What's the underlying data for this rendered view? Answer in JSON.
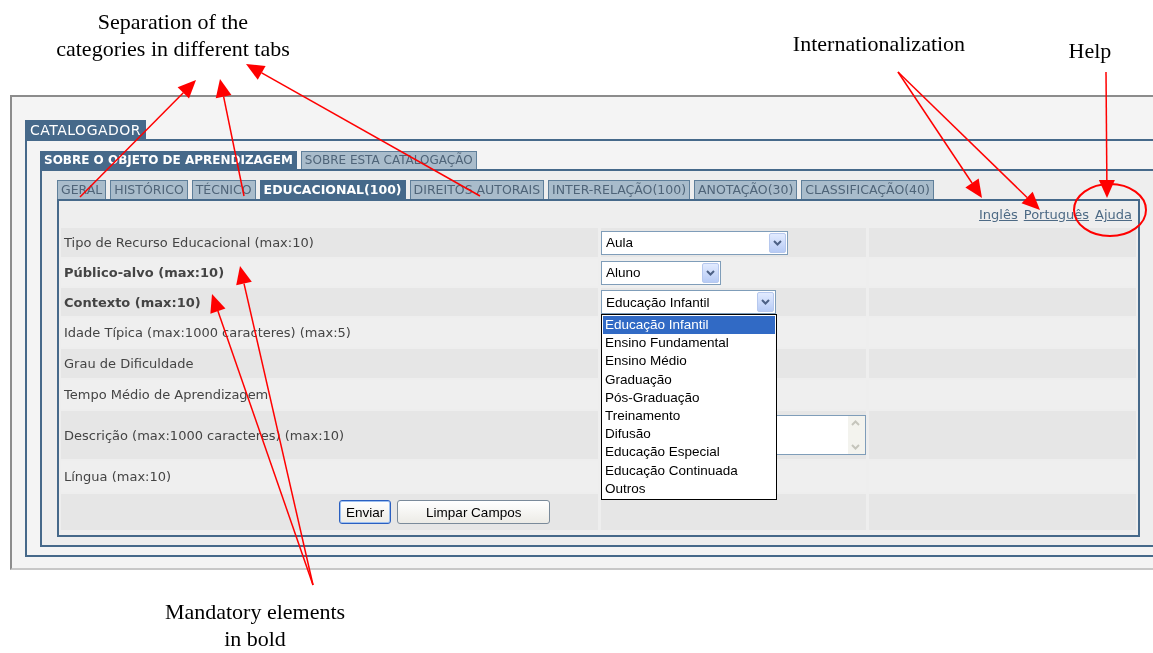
{
  "annotations": [
    {
      "lines": [
        "Separation of the",
        "categories in different tabs"
      ]
    },
    {
      "lines": [
        "Internationalization"
      ]
    },
    {
      "lines": [
        "Help"
      ]
    },
    {
      "lines": [
        "Mandatory elements",
        "in bold"
      ]
    }
  ],
  "app": {
    "title": "CATALOGADOR",
    "sections": [
      {
        "label": "SOBRE O OBJETO DE APRENDIZAGEM",
        "selected": true
      },
      {
        "label": "SOBRE ESTA CATALOGAÇÃO",
        "selected": false
      }
    ],
    "tabs": [
      {
        "label": "GERAL",
        "selected": false
      },
      {
        "label": "HISTÓRICO",
        "selected": false
      },
      {
        "label": "TÉCNICO",
        "selected": false
      },
      {
        "label": "EDUCACIONAL(100)",
        "selected": true
      },
      {
        "label": "DIREITOS AUTORAIS",
        "selected": false
      },
      {
        "label": "INTER-RELAÇÃO(100)",
        "selected": false
      },
      {
        "label": "ANOTAÇÃO(30)",
        "selected": false
      },
      {
        "label": "CLASSIFICAÇÃO(40)",
        "selected": false
      }
    ],
    "links": [
      "Inglês",
      "Português",
      "Ajuda"
    ],
    "fields": [
      {
        "label": "Tipo de Recurso Educacional (max:10)",
        "required": false,
        "control": {
          "kind": "select",
          "value": "Aula",
          "expanded": false
        }
      },
      {
        "label": "Público-alvo (max:10)",
        "required": true,
        "control": {
          "kind": "select",
          "value": "Aluno",
          "expanded": false
        }
      },
      {
        "label": "Contexto (max:10)",
        "required": true,
        "control": {
          "kind": "select",
          "value": "Educação Infantil",
          "expanded": true
        }
      },
      {
        "label": "Idade Típica (max:1000 caracteres) (max:5)",
        "required": false
      },
      {
        "label": "Grau de Dificuldade",
        "required": false
      },
      {
        "label": "Tempo Médio de Aprendizagem",
        "required": false
      },
      {
        "label": "Descrição (max:1000 caracteres) (max:10)",
        "required": false,
        "control": {
          "kind": "textarea"
        }
      },
      {
        "label": "Língua (max:10)",
        "required": false
      }
    ],
    "options": [
      {
        "label": "Educação Infantil",
        "selected": true
      },
      {
        "label": "Ensino Fundamental",
        "selected": false
      },
      {
        "label": "Ensino Médio",
        "selected": false
      },
      {
        "label": "Graduação",
        "selected": false
      },
      {
        "label": "Pós-Graduação",
        "selected": false
      },
      {
        "label": "Treinamento",
        "selected": false
      },
      {
        "label": "Difusão",
        "selected": false
      },
      {
        "label": "Educação Especial",
        "selected": false
      },
      {
        "label": "Educação Continuada",
        "selected": false
      },
      {
        "label": "Outros",
        "selected": false
      }
    ],
    "buttons": [
      {
        "label": "Enviar",
        "focused": true
      },
      {
        "label": "Limpar Campos",
        "focused": false
      }
    ]
  }
}
